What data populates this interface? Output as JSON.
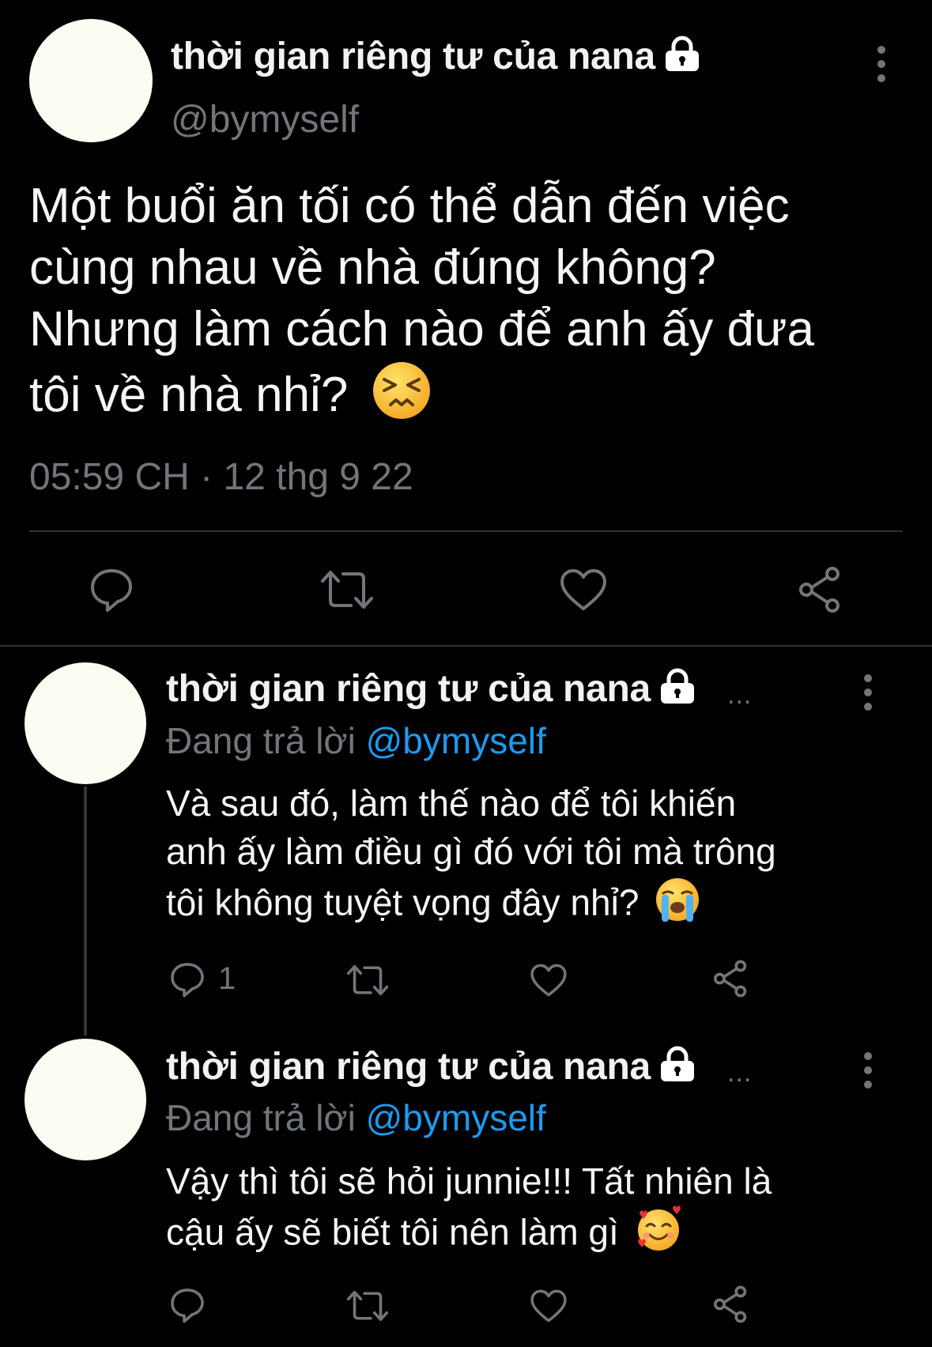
{
  "main_tweet": {
    "display_name": "thời gian riêng tư của nana",
    "handle": "@bymyself",
    "text_lines": [
      "Một buổi ăn tối có thể dẫn đến việc",
      "cùng nhau về nhà đúng không?",
      "Nhưng làm cách nào để anh ấy đưa",
      "tôi về nhà nhỉ?"
    ],
    "emoji": "confounded-face",
    "timestamp": "05:59 CH · 12 thg 9 22",
    "actions": [
      "reply-icon",
      "retweet-icon",
      "like-icon",
      "share-icon"
    ]
  },
  "replies": [
    {
      "display_name": "thời gian riêng tư của nana",
      "ellipsis": "...",
      "replying_label": "Đang trả lời",
      "replying_to": "@bymyself",
      "text_lines": [
        "Và sau đó, làm thế nào để tôi khiến",
        "anh ấy làm điều gì đó với tôi mà trông",
        "tôi không tuyệt vọng đây nhỉ?"
      ],
      "emoji": "loudly-crying-face",
      "reply_count": "1"
    },
    {
      "display_name": "thời gian riêng tư của nana",
      "ellipsis": "...",
      "replying_label": "Đang trả lời",
      "replying_to": "@bymyself",
      "text_lines": [
        "Vậy thì tôi sẽ hỏi junnie!!! Tất nhiên là",
        "cậu ấy sẽ biết tôi nên làm gì"
      ],
      "emoji": "smiling-face-with-hearts",
      "reply_count": ""
    }
  ],
  "colors": {
    "background": "#000000",
    "text": "#e7e9ea",
    "muted": "#71767b",
    "link": "#1d9bf0",
    "divider": "#2f3336"
  }
}
